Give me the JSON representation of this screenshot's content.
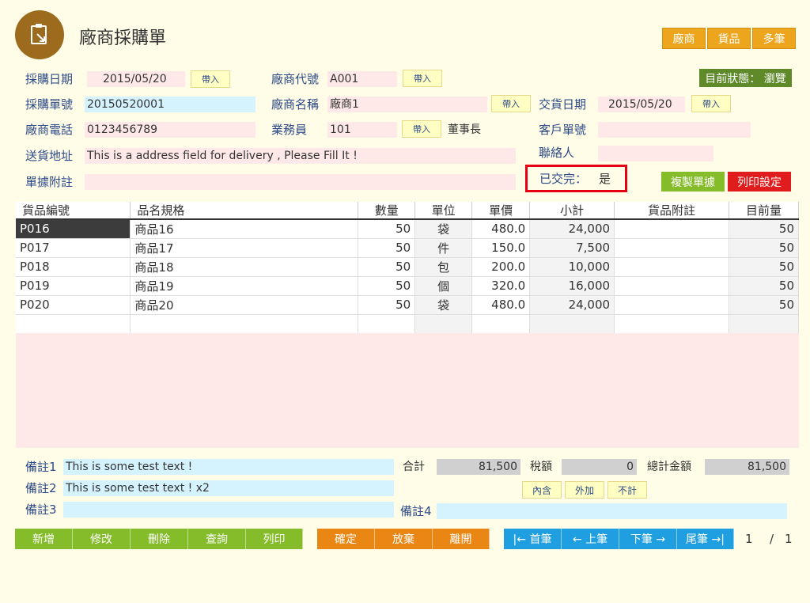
{
  "header": {
    "title": "廠商採購單",
    "top_buttons": [
      "廠商",
      "貨品",
      "多筆"
    ],
    "status": "目前狀態： 瀏覽"
  },
  "form": {
    "purchase_date_label": "採購日期",
    "purchase_date": "2015/05/20",
    "purchase_no_label": "採購單號",
    "purchase_no": "20150520001",
    "phone_label": "廠商電話",
    "phone": "0123456789",
    "address_label": "送貨地址",
    "address": "This is a address field for delivery , Please Fill It !",
    "remark_label": "單據附註",
    "remark": "",
    "vendor_code_label": "廠商代號",
    "vendor_code": "A001",
    "vendor_name_label": "廠商名稱",
    "vendor_name": "廠商1",
    "salesman_label": "業務員",
    "salesman": "101",
    "salesman_name": "董事長",
    "delivery_date_label": "交貨日期",
    "delivery_date": "2015/05/20",
    "customer_no_label": "客戶單號",
    "customer_no": "",
    "contact_label": "聯絡人",
    "contact": "",
    "delivered_label": "已交完：",
    "delivered": "是",
    "import_label": "帶入",
    "copy_button": "複製單據",
    "print_settings_button": "列印設定"
  },
  "table": {
    "columns": [
      "貨品編號",
      "品名規格",
      "數量",
      "單位",
      "單價",
      "小計",
      "貨品附註",
      "目前量"
    ],
    "rows": [
      [
        "P016",
        "商品16",
        "50",
        "袋",
        "480.0",
        "24,000",
        "",
        "50"
      ],
      [
        "P017",
        "商品17",
        "50",
        "件",
        "150.0",
        "7,500",
        "",
        "50"
      ],
      [
        "P018",
        "商品18",
        "50",
        "包",
        "200.0",
        "10,000",
        "",
        "50"
      ],
      [
        "P019",
        "商品19",
        "50",
        "個",
        "320.0",
        "16,000",
        "",
        "50"
      ],
      [
        "P020",
        "商品20",
        "50",
        "袋",
        "480.0",
        "24,000",
        "",
        "50"
      ]
    ]
  },
  "footer": {
    "note1_label": "備註1",
    "note1": "This is some test text !",
    "note2_label": "備註2",
    "note2": "This is some test text ! x2",
    "note3_label": "備註3",
    "note3": "",
    "note4_label": "備註4",
    "note4": "",
    "subtotal_label": "合計",
    "subtotal": "81,500",
    "tax_label": "稅額",
    "tax": "0",
    "total_label": "總計金額",
    "total": "81,500",
    "tax_buttons": [
      "內含",
      "外加",
      "不計"
    ]
  },
  "actions": {
    "crud": [
      "新增",
      "修改",
      "刪除",
      "查詢",
      "列印"
    ],
    "confirm": [
      "確定",
      "放棄",
      "離開"
    ],
    "nav": [
      "|← 首筆",
      "← 上筆",
      "下筆 →",
      "尾筆 →|"
    ],
    "page_current": "1",
    "page_sep": "/",
    "page_total": "1"
  },
  "colors": {
    "brand": "#9c6b1e",
    "accent_orange": "#eda51d",
    "status_green": "#5f8a2a",
    "alert_red": "#e60012"
  },
  "icons": {
    "logo": "clipboard-icon"
  }
}
